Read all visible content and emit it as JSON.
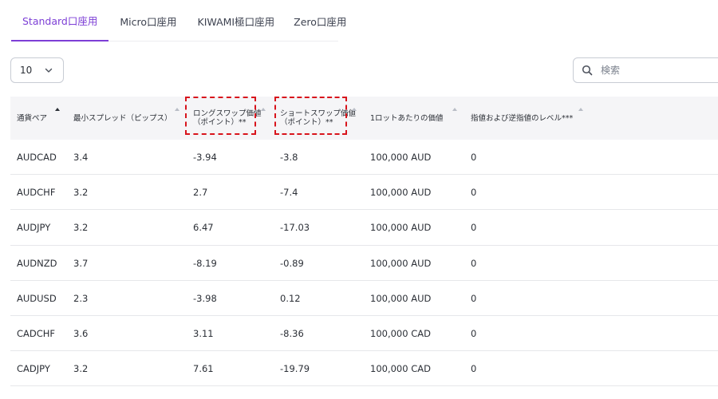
{
  "tabs": [
    {
      "label": "Standard口座用",
      "active": true
    },
    {
      "label": "Micro口座用",
      "active": false
    },
    {
      "label": "KIWAMI極口座用",
      "active": false
    },
    {
      "label": "Zero口座用",
      "active": false
    }
  ],
  "page_size": {
    "value": "10"
  },
  "search": {
    "placeholder": "検索",
    "icon": "search-icon"
  },
  "table": {
    "columns": [
      {
        "line1": "通貨ペア",
        "line2": ""
      },
      {
        "line1": "最小スプレッド（ピップス）",
        "line2": ""
      },
      {
        "line1": "ロングスワップ価値",
        "line2": "（ポイント）**"
      },
      {
        "line1": "ショートスワップ価値",
        "line2": "（ポイント）**"
      },
      {
        "line1": "1ロットあたりの価値",
        "line2": ""
      },
      {
        "line1": "指値および逆指値のレベル***",
        "line2": ""
      }
    ],
    "rows": [
      [
        "AUDCAD",
        "3.4",
        "-3.94",
        "-3.8",
        "100,000 AUD",
        "0"
      ],
      [
        "AUDCHF",
        "3.2",
        "2.7",
        "-7.4",
        "100,000 AUD",
        "0"
      ],
      [
        "AUDJPY",
        "3.2",
        "6.47",
        "-17.03",
        "100,000 AUD",
        "0"
      ],
      [
        "AUDNZD",
        "3.7",
        "-8.19",
        "-0.89",
        "100,000 AUD",
        "0"
      ],
      [
        "AUDUSD",
        "2.3",
        "-3.98",
        "0.12",
        "100,000 AUD",
        "0"
      ],
      [
        "CADCHF",
        "3.6",
        "3.11",
        "-8.36",
        "100,000 CAD",
        "0"
      ],
      [
        "CADJPY",
        "3.2",
        "7.61",
        "-19.79",
        "100,000 CAD",
        "0"
      ]
    ]
  },
  "colors": {
    "accent": "#7d3fd6",
    "highlight": "#d8141c"
  }
}
